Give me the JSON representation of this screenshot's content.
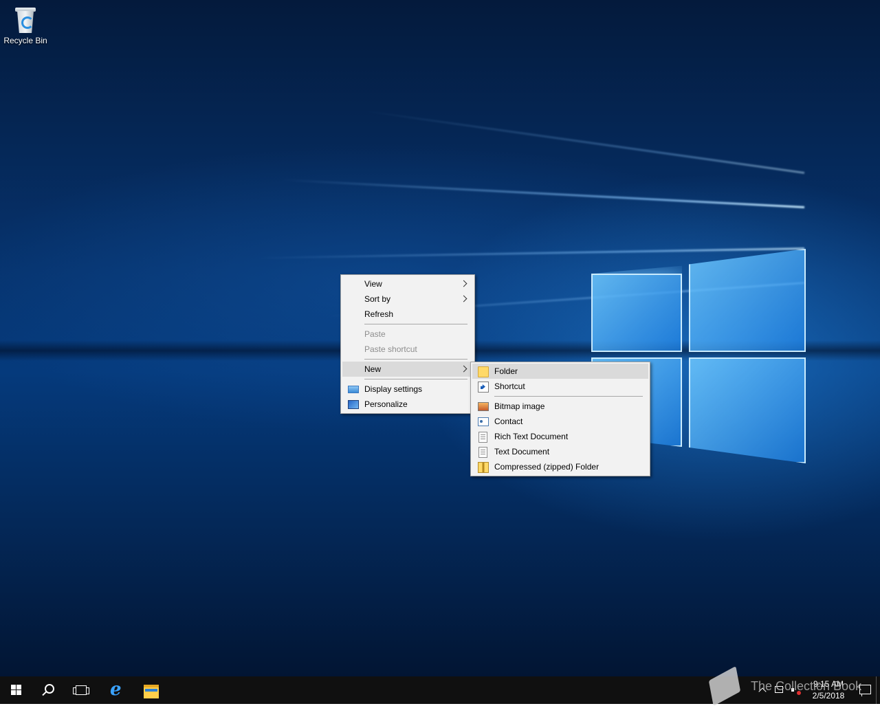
{
  "desktop": {
    "icons": [
      {
        "label": "Recycle Bin",
        "icon": "recycle-bin-icon"
      }
    ]
  },
  "context_menu": {
    "items": [
      {
        "label": "View",
        "submenu": true
      },
      {
        "label": "Sort by",
        "submenu": true
      },
      {
        "label": "Refresh"
      },
      {
        "label": "Paste",
        "disabled": true
      },
      {
        "label": "Paste shortcut",
        "disabled": true
      },
      {
        "label": "New",
        "submenu": true,
        "highlighted": true
      },
      {
        "label": "Display settings",
        "icon": "display-icon"
      },
      {
        "label": "Personalize",
        "icon": "personalize-icon"
      }
    ]
  },
  "new_submenu": {
    "items": [
      {
        "label": "Folder",
        "icon": "folder-icon",
        "highlighted": true
      },
      {
        "label": "Shortcut",
        "icon": "shortcut-icon"
      },
      {
        "label": "Bitmap image",
        "icon": "bitmap-icon"
      },
      {
        "label": "Contact",
        "icon": "contact-icon"
      },
      {
        "label": "Rich Text Document",
        "icon": "rich-text-icon"
      },
      {
        "label": "Text Document",
        "icon": "text-document-icon"
      },
      {
        "label": "Compressed (zipped) Folder",
        "icon": "zip-folder-icon"
      }
    ]
  },
  "taskbar": {
    "pinned": [
      {
        "name": "start-button",
        "icon": "windows-logo-icon"
      },
      {
        "name": "search-button",
        "icon": "search-icon"
      },
      {
        "name": "task-view-button",
        "icon": "task-view-icon"
      },
      {
        "name": "internet-explorer-button",
        "icon": "internet-explorer-icon"
      },
      {
        "name": "file-explorer-button",
        "icon": "file-explorer-icon"
      }
    ],
    "clock": {
      "time": "9:15 AM",
      "date": "2/5/2018"
    }
  },
  "watermark": {
    "text": "The Collection Book"
  },
  "colors": {
    "taskbar": "#101010",
    "menu_background": "#f2f2f2",
    "menu_highlight": "#dadada",
    "disabled_text": "#8d8d8d"
  }
}
